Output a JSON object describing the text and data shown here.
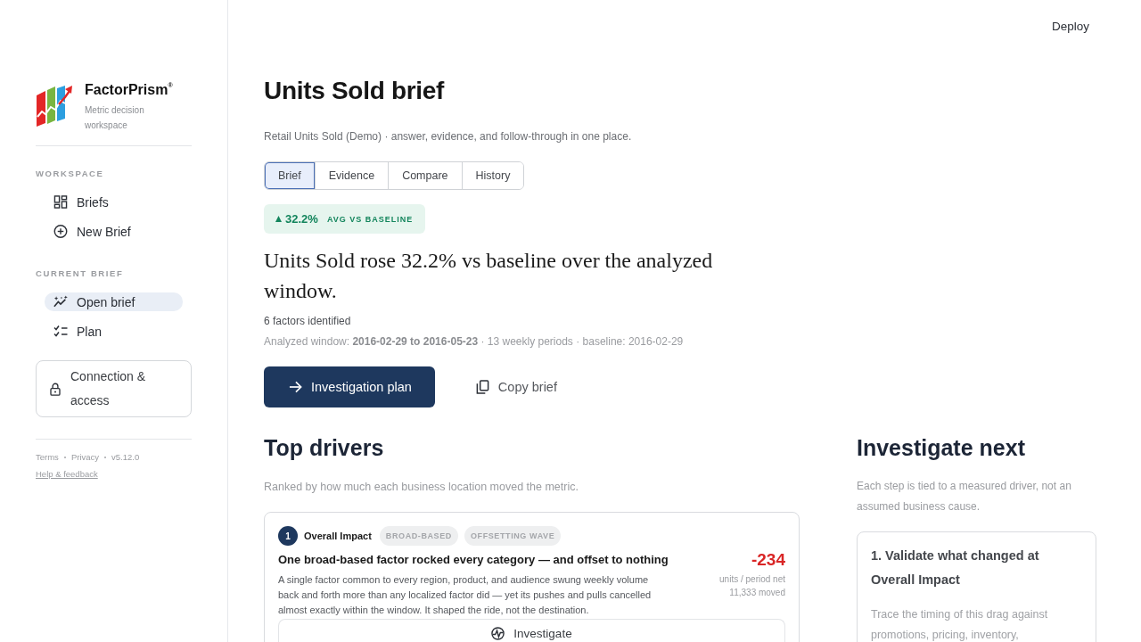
{
  "header": {
    "action": "Deploy"
  },
  "sidebar": {
    "brand": {
      "name": "FactorPrism$^{®}$",
      "tagline": "Metric decision workspace"
    },
    "sections": [
      {
        "label": "WORKSPACE",
        "items": [
          {
            "label": "Briefs",
            "selected": false
          },
          {
            "label": "New Brief",
            "selected": false
          }
        ]
      },
      {
        "label": "CURRENT BRIEF",
        "items": [
          {
            "label": "Open brief",
            "selected": true
          },
          {
            "label": "Plan",
            "selected": false
          }
        ]
      }
    ],
    "connection": {
      "label": "Connection & access"
    },
    "footer": {
      "links": [
        "Terms",
        "Privacy"
      ],
      "version": "v5.12.0",
      "help": "Help & feedback"
    }
  },
  "brief": {
    "title": "Units Sold brief",
    "subtitle": "Retail Units Sold (Demo) · answer, evidence, and follow-through in one place.",
    "tabs": [
      {
        "label": "Brief",
        "selected": true
      },
      {
        "label": "Evidence",
        "selected": false
      },
      {
        "label": "Compare",
        "selected": false
      },
      {
        "label": "History",
        "selected": false
      }
    ],
    "badge": {
      "up": true,
      "value": "32.2%",
      "label": "AVG VS BASELINE"
    },
    "headline": "Units Sold rose 32.2% vs baseline over the analyzed window.",
    "factors": "6 factors identified",
    "window": "Analyzed window: **2016-02-29 to 2016-05-23** · 13 weekly periods · baseline: 2016-02-29",
    "actions": [
      {
        "kind": "primary",
        "label": "Investigation plan"
      },
      {
        "kind": "secondary",
        "label": "Copy brief"
      }
    ]
  },
  "top_drivers": {
    "title": "Top drivers",
    "subtitle": "Ranked by how much each business location moved the metric.",
    "drivers": [
      {
        "rank": "1",
        "name": "Overall Impact",
        "tags": [
          "BROAD-BASED",
          "OFFSETTING WAVE"
        ],
        "title": "One broad-based factor rocked every category — and offset to nothing",
        "body": "A single factor common to every region, product, and audience swung weekly volume back and forth more than any localized factor did — yet its pushes and pulls cancelled almost exactly within the window. It shaped the ride, not the destination.",
        "value": "-234",
        "negative": true,
        "unit": "units / period net",
        "moved": "11,333 moved",
        "action": "Investigate"
      }
    ]
  },
  "investigate_next": {
    "title": "Investigate next",
    "subtitle": "Each step is tied to a measured driver, not an assumed business cause.",
    "steps": [
      {
        "title": "1. Validate what changed at Overall Impact",
        "body": "Trace the timing of this drag against promotions, pricing, inventory,"
      }
    ]
  }
}
